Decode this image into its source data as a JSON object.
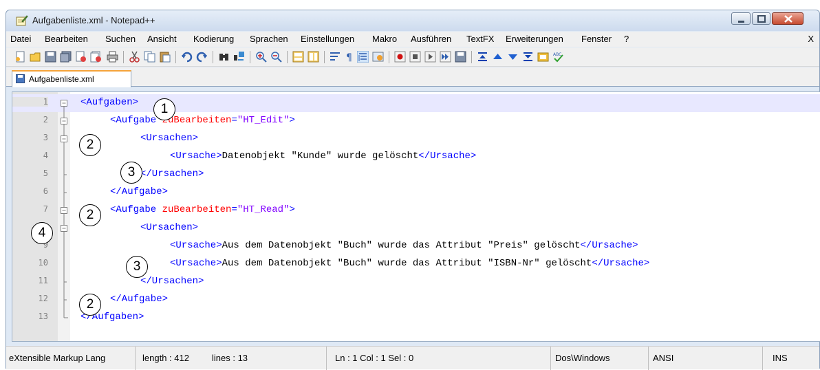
{
  "window": {
    "title": "Aufgabenliste.xml - Notepad++"
  },
  "menu": {
    "items": [
      "Datei",
      "Bearbeiten",
      "Suchen",
      "Ansicht",
      "Kodierung",
      "Sprachen",
      "Einstellungen",
      "Makro",
      "Ausführen",
      "TextFX",
      "Erweiterungen",
      "Fenster",
      "?"
    ],
    "close_label": "X"
  },
  "toolbar": {
    "icons": [
      "new-file-icon",
      "open-file-icon",
      "save-icon",
      "save-all-icon",
      "close-icon",
      "close-all-icon",
      "print-icon",
      "cut-icon",
      "copy-icon",
      "paste-icon",
      "undo-icon",
      "redo-icon",
      "find-icon",
      "replace-icon",
      "zoom-in-icon",
      "zoom-out-icon",
      "sync-vertical-icon",
      "sync-horizontal-icon",
      "word-wrap-icon",
      "show-all-chars-icon",
      "indent-guide-icon",
      "user-define-icon",
      "record-macro-icon",
      "stop-macro-icon",
      "play-macro-icon",
      "run-macro-multiple-icon",
      "save-macro-icon",
      "collapse-icon",
      "up-icon",
      "down-icon",
      "expand-icon",
      "doc-map-icon",
      "spellcheck-icon"
    ]
  },
  "tab": {
    "label": "Aufgabenliste.xml"
  },
  "editor": {
    "lines": [
      {
        "n": "1"
      },
      {
        "n": "2"
      },
      {
        "n": "3"
      },
      {
        "n": "4"
      },
      {
        "n": "5"
      },
      {
        "n": "6"
      },
      {
        "n": "7"
      },
      {
        "n": "8"
      },
      {
        "n": "9"
      },
      {
        "n": "10"
      },
      {
        "n": "11"
      },
      {
        "n": "12"
      },
      {
        "n": "13"
      }
    ],
    "code": {
      "l1_tag": "<Aufgaben>",
      "l2_open": "<Aufgabe ",
      "l2_attr": "zuBearbeiten",
      "l2_eq": "=",
      "l2_val": "\"HT_Edit\"",
      "l2_close": ">",
      "l3_tag": "<Ursachen>",
      "l4_open": "<Ursache>",
      "l4_text": "Datenobjekt \"Kunde\" wurde gelöscht",
      "l4_close": "</Ursache>",
      "l5_tag": "</Ursachen>",
      "l6_tag": "</Aufgabe>",
      "l7_open": "<Aufgabe ",
      "l7_attr": "zuBearbeiten",
      "l7_eq": "=",
      "l7_val": "\"HT_Read\"",
      "l7_close": ">",
      "l8_tag": "<Ursachen>",
      "l9_open": "<Ursache>",
      "l9_text": "Aus dem Datenobjekt \"Buch\" wurde das Attribut \"Preis\" gelöscht",
      "l9_close": "</Ursache>",
      "l10_open": "<Ursache>",
      "l10_text": "Aus dem Datenobjekt \"Buch\" wurde das Attribut \"ISBN-Nr\" gelöscht",
      "l10_close": "</Ursache>",
      "l11_tag": "</Ursachen>",
      "l12_tag": "</Aufgabe>",
      "l13_tag": "</Aufgaben>"
    }
  },
  "callouts": [
    "1",
    "2",
    "3",
    "2",
    "4",
    "3",
    "2"
  ],
  "status": {
    "language": "eXtensible Markup Lang",
    "length": "length : 412",
    "lines": "lines : 13",
    "position": "Ln : 1   Col : 1   Sel : 0",
    "eol": "Dos\\Windows",
    "encoding": "ANSI",
    "mode": "INS"
  },
  "colors": {
    "tag": "#0000ff",
    "attribute": "#ff0000",
    "value": "#8000ff",
    "current_line": "#e8e8ff"
  }
}
